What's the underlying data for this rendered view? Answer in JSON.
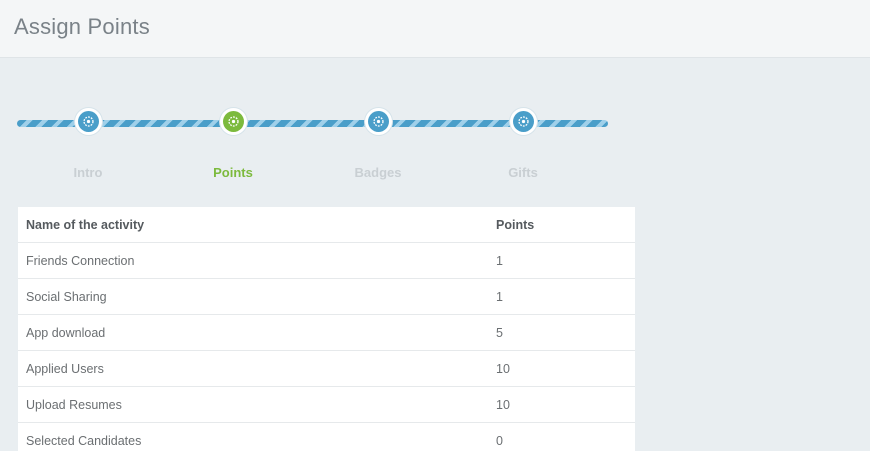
{
  "header": {
    "title": "Assign Points"
  },
  "wizard": {
    "steps": [
      {
        "label": "Intro",
        "active": false,
        "icon": "gear-icon"
      },
      {
        "label": "Points",
        "active": true,
        "icon": "gear-icon"
      },
      {
        "label": "Badges",
        "active": false,
        "icon": "gear-icon"
      },
      {
        "label": "Gifts",
        "active": false,
        "icon": "gear-icon"
      }
    ],
    "colors": {
      "inactive": "#4a9ec9",
      "active": "#7cba3d"
    }
  },
  "table": {
    "columns": [
      "Name of the activity",
      "Points"
    ],
    "rows": [
      {
        "activity": "Friends Connection",
        "points": "1"
      },
      {
        "activity": "Social Sharing",
        "points": "1"
      },
      {
        "activity": "App download",
        "points": "5"
      },
      {
        "activity": "Applied Users",
        "points": "10"
      },
      {
        "activity": "Upload Resumes",
        "points": "10"
      },
      {
        "activity": "Selected Candidates",
        "points": "0"
      }
    ]
  }
}
